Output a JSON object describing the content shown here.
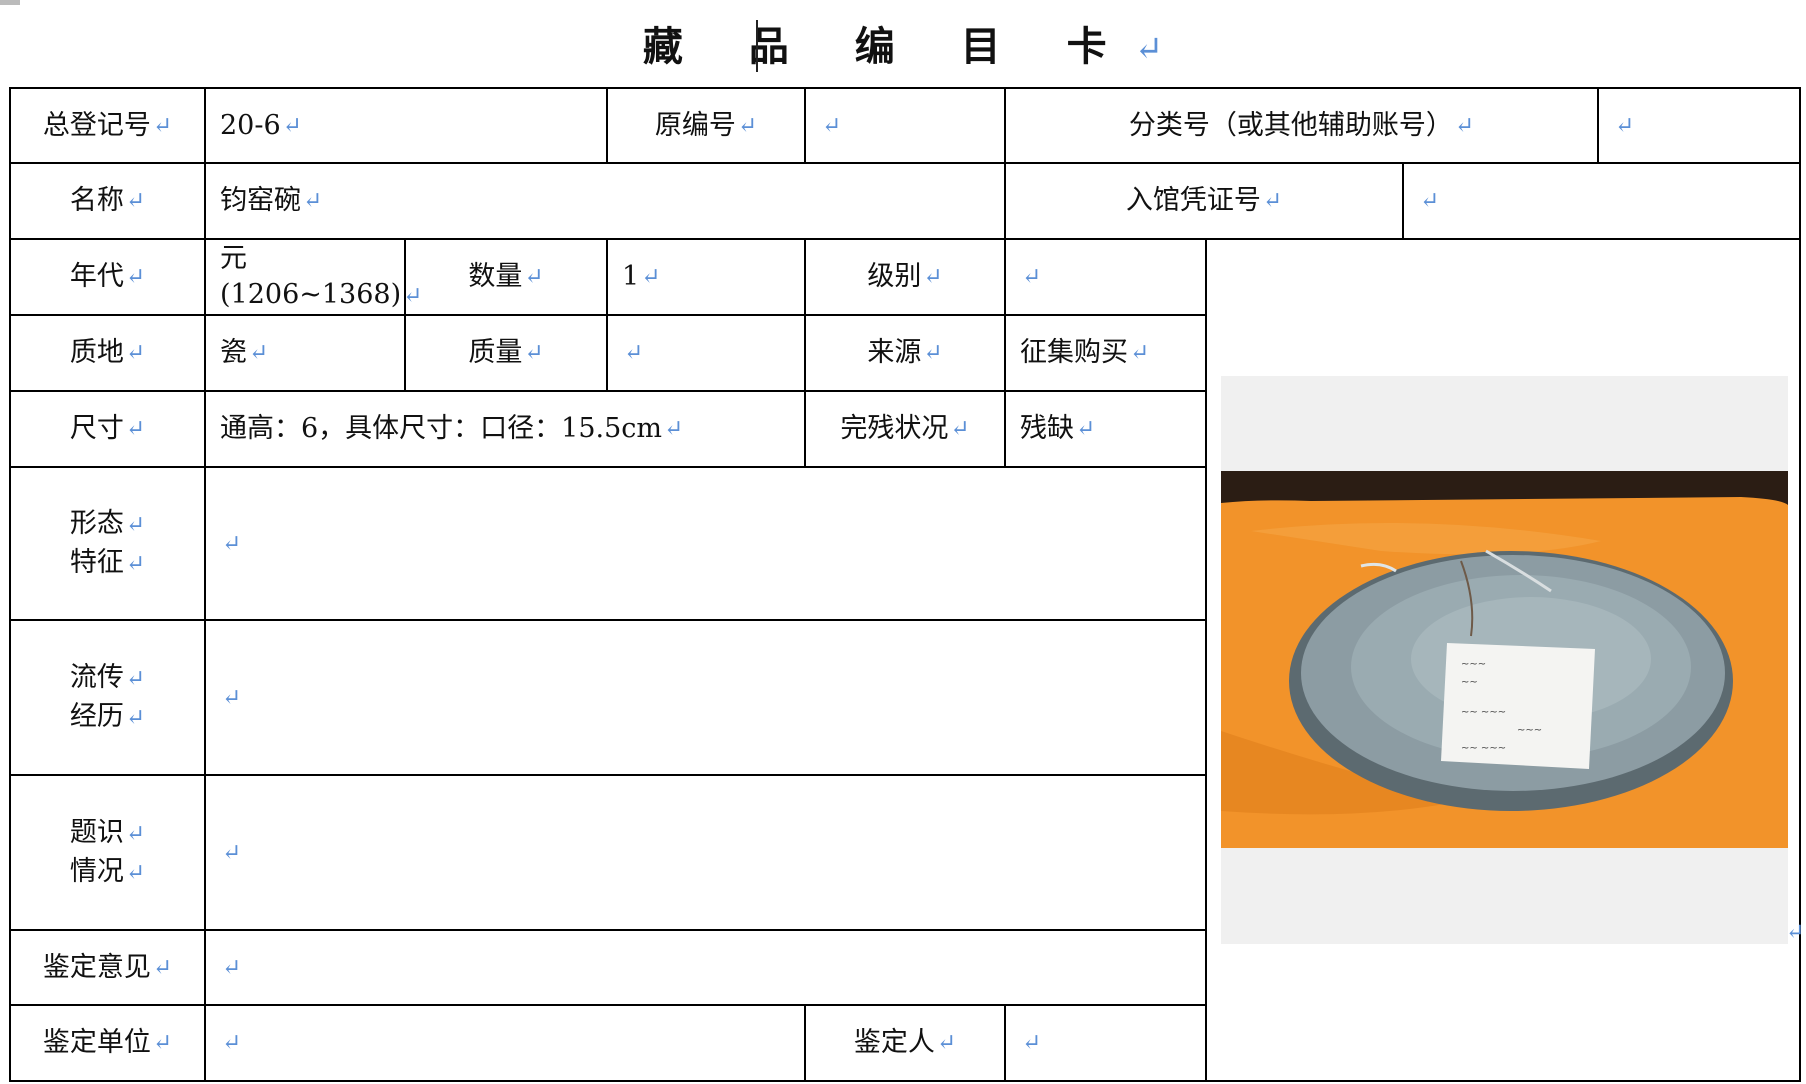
{
  "title": "藏 品 编 目 卡",
  "paragraph_mark": "↵",
  "labels": {
    "registration_no": "总登记号",
    "original_no": "原编号",
    "classification_no": "分类号（或其他辅助账号）",
    "name": "名称",
    "entry_voucher_no": "入馆凭证号",
    "era": "年代",
    "quantity": "数量",
    "grade": "级别",
    "material": "质地",
    "weight": "质量",
    "source": "来源",
    "size": "尺寸",
    "condition": "完残状况",
    "features_1": "形态",
    "features_2": "特征",
    "provenance_1": "流传",
    "provenance_2": "经历",
    "inscription_1": "题识",
    "inscription_2": "情况",
    "appraisal_opinion": "鉴定意见",
    "appraisal_unit": "鉴定单位",
    "appraiser": "鉴定人"
  },
  "values": {
    "registration_no": "20-6",
    "original_no": "",
    "classification_no": "",
    "name": "钧窑碗",
    "entry_voucher_no": "",
    "era_line1": "元",
    "era_line2": "(1206~1368)",
    "quantity": "1",
    "grade": "",
    "material": "瓷",
    "weight": "",
    "source": "征集购买",
    "size": "通高：6，具体尺寸：口径：15.5cm",
    "condition": "残缺",
    "features": "",
    "provenance": "",
    "inscription": "",
    "appraisal_opinion": "",
    "appraisal_unit": "",
    "appraiser": ""
  },
  "photo": {
    "description_icon": "jun-ware-bowl-photo",
    "colors": {
      "cloth": "#f2932a",
      "glaze": "#8fa0a6",
      "background": "#2b1d14"
    }
  }
}
